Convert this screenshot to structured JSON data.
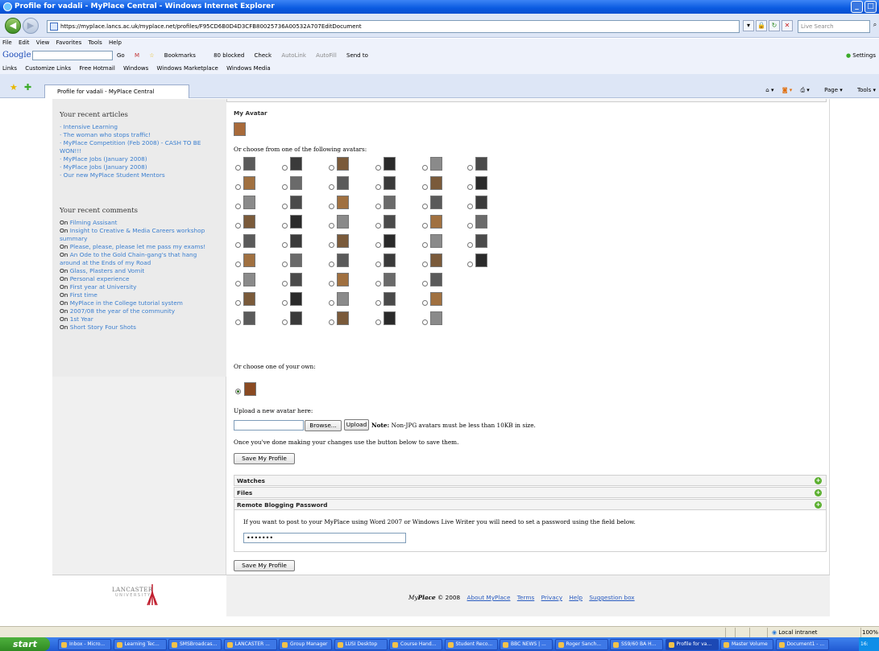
{
  "window": {
    "title": "Profile for vadali - MyPlace Central - Windows Internet Explorer",
    "address": "https://myplace.lancs.ac.uk/myplace.net/profiles/F95CD6B0D4D3CFB80025736A00532A707EditDocument",
    "search_placeholder": "Live Search",
    "menus": [
      "File",
      "Edit",
      "View",
      "Favorites",
      "Tools",
      "Help"
    ],
    "google_label": "Google",
    "google_toolbar": [
      "Go",
      "M",
      "Bookmarks",
      "80 blocked",
      "Check",
      "AutoLink",
      "AutoFill",
      "Send to"
    ],
    "google_settings": "Settings",
    "links_label": "Links",
    "links": [
      "Customize Links",
      "Free Hotmail",
      "Windows",
      "Windows Marketplace",
      "Windows Media"
    ],
    "tab_title": "Profile for vadali - MyPlace Central",
    "command_bar": [
      "Page",
      "Tools"
    ]
  },
  "sidebar": {
    "articles_heading": "Your recent articles",
    "articles": [
      "Intensive Learning",
      "The woman who stops traffic!",
      "MyPlace Competition (Feb 2008) - CASH TO BE WON!!!",
      "MyPlace Jobs (January 2008)",
      "MyPlace Jobs (January 2008)",
      "Our new MyPlace Student Mentors"
    ],
    "comments_heading": "Your recent comments",
    "comment_prefix": "On",
    "comments": [
      "Filming Assisant",
      "Insight to Creative & Media Careers workshop summary",
      "Please, please, please let me pass my exams!",
      "An Ode to the Gold Chain-gang's that hang around at the Ends of my Road",
      "Glass, Plasters and Vomit",
      "Personal experience",
      "First year at University",
      "First time",
      "MyPlace in the College tutorial system",
      "2007/08 the year of the community",
      "1st Year",
      "Short Story Four Shots"
    ]
  },
  "main": {
    "avatar_heading": "My Avatar",
    "choose_text": "Or choose from one of the following avatars:",
    "own_text": "Or choose one of your own:",
    "upload_label": "Upload a new avatar here:",
    "browse_label": "Browse...",
    "upload_button": "Upload",
    "note_bold": "Note:",
    "note_text": "Non-JPG avatars must be less than 10KB in size.",
    "save_instruction": "Once you've done making your changes use the button below to save them.",
    "save_button": "Save My Profile",
    "sections": [
      "Watches",
      "Files",
      "Remote Blogging Password"
    ],
    "blog_instruction": "If you want to post to your MyPlace using Word 2007 or Windows Live Writer you will need to set a password using the field below.",
    "password_value": "•••••••",
    "save_button_2": "Save My Profile"
  },
  "footer": {
    "university": "LANCASTER",
    "university_sub": "UNIVERSITY",
    "brand_my": "My",
    "brand_place": "Place",
    "copyright": "© 2008",
    "links": [
      "About MyPlace",
      "Terms",
      "Privacy",
      "Help",
      "Suggestion box"
    ]
  },
  "statusbar": {
    "zone": "Local intranet",
    "zoom": "100%"
  },
  "taskbar": {
    "start": "start",
    "tasks": [
      "Inbox - Micro...",
      "Learning Tec...",
      "SMSBroadcas...",
      "LANCASTER ...",
      "Group Manager",
      "LUSI Desktop",
      "Course Hand...",
      "Student Reco...",
      "BBC NEWS | ...",
      "Roger Sanch...",
      "SS9/60 BA H...",
      "Profile for va...",
      "Master Volume",
      "Document1 - ..."
    ],
    "clock": "16:"
  },
  "colors": {
    "link": "#3a7ecf",
    "titlebar": "#0a5ae0",
    "plus": "#5cb030"
  }
}
